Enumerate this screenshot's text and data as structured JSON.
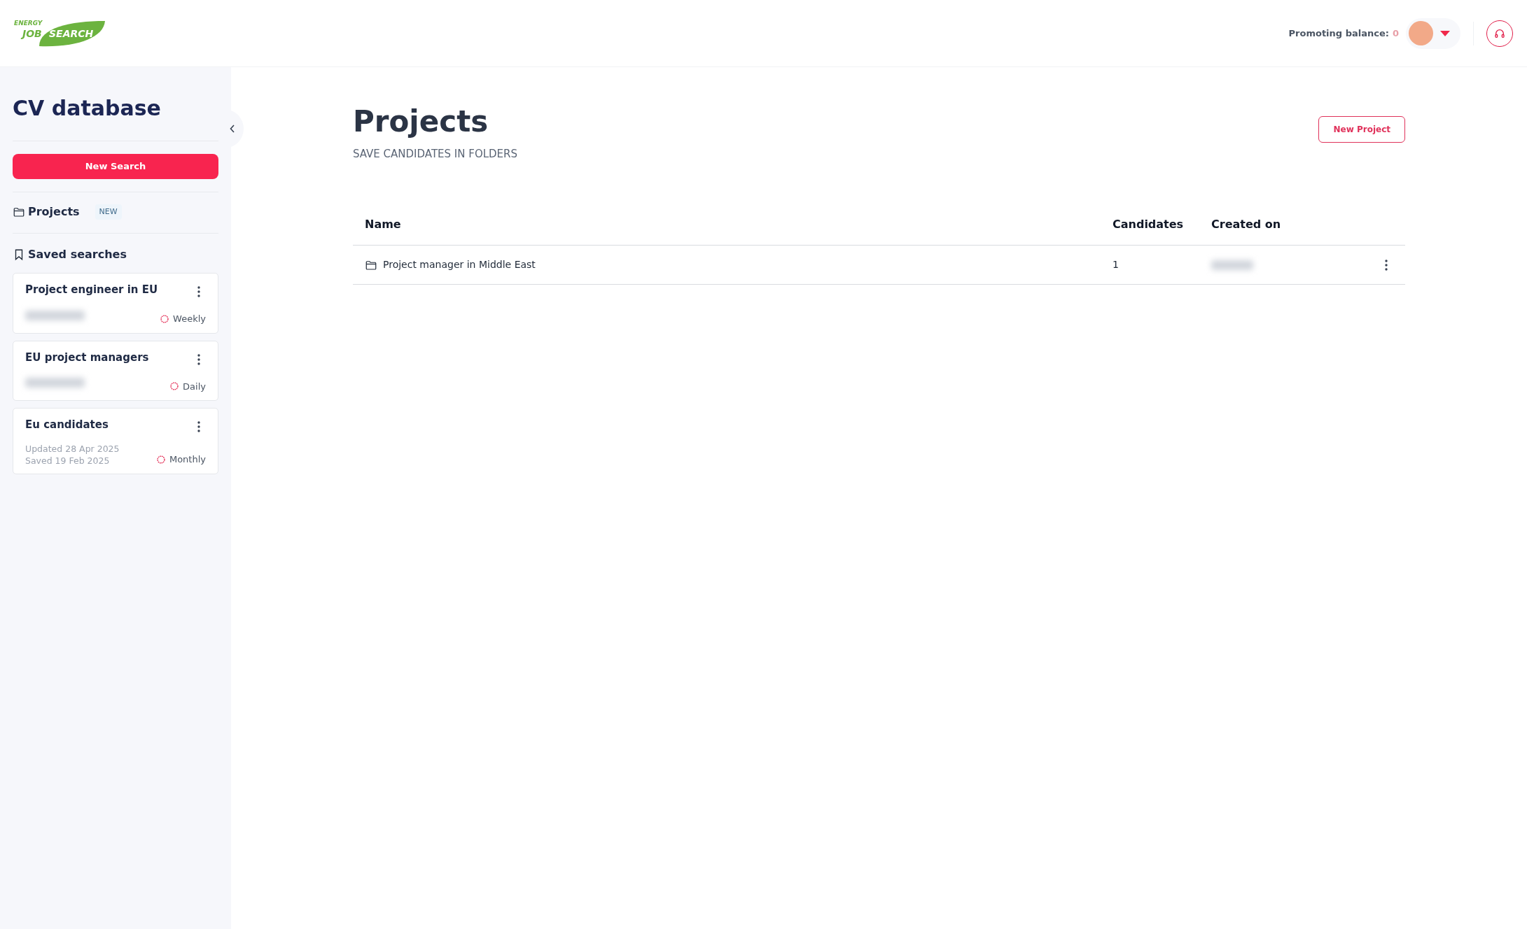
{
  "logo": {
    "top": "ENERGY",
    "left": "JOB",
    "right": "SEARCH"
  },
  "header": {
    "balance_label": "Promoting balance:",
    "balance_value": "0"
  },
  "sidebar": {
    "title": "CV database",
    "new_search": "New Search",
    "projects": {
      "label": "Projects",
      "badge": "NEW"
    },
    "saved_title": "Saved searches",
    "saved": [
      {
        "name": "Project engineer in EU",
        "redacted": true,
        "frequency": "Weekly"
      },
      {
        "name": "EU project managers",
        "redacted": true,
        "frequency": "Daily"
      },
      {
        "name": "Eu candidates",
        "redacted": false,
        "updated_label": "Updated",
        "updated": "28 Apr 2025",
        "saved_label": "Saved",
        "saved": "19 Feb 2025",
        "frequency": "Monthly"
      }
    ]
  },
  "main": {
    "title": "Projects",
    "subtitle": "SAVE CANDIDATES IN FOLDERS",
    "new_project": "New Project",
    "table": {
      "columns": [
        "Name",
        "Candidates",
        "Created on"
      ],
      "rows": [
        {
          "name": "Project manager in Middle East",
          "candidates": "1",
          "created_redacted": true
        }
      ]
    }
  }
}
